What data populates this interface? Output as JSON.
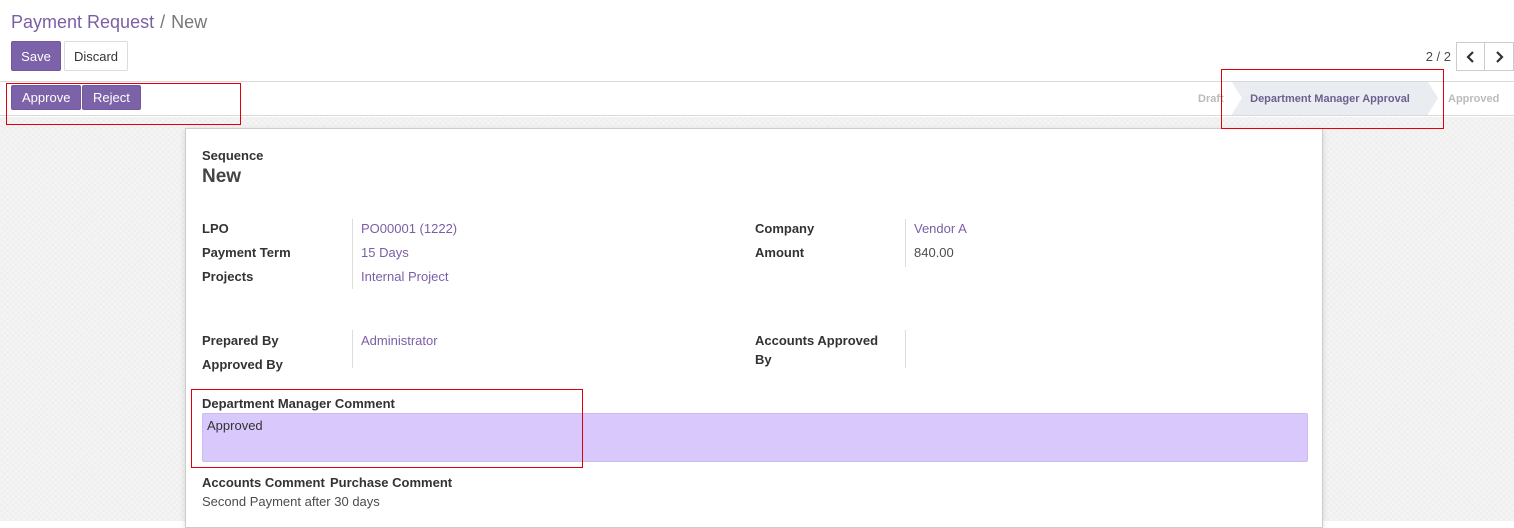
{
  "breadcrumb": {
    "parent": "Payment Request",
    "separator": "/",
    "current": "New"
  },
  "toolbar": {
    "save_label": "Save",
    "discard_label": "Discard"
  },
  "pager": {
    "value": "2 / 2"
  },
  "statusbar": {
    "approve_label": "Approve",
    "reject_label": "Reject",
    "stages": [
      "Draft",
      "Department Manager Approval",
      "Approved"
    ],
    "active_stage": "Department Manager Approval"
  },
  "form": {
    "sequence_label": "Sequence",
    "sequence_value": "New",
    "lpo_label": "LPO",
    "lpo_value": "PO00001 (1222)",
    "payment_term_label": "Payment Term",
    "payment_term_value": "15 Days",
    "projects_label": "Projects",
    "projects_value": "Internal Project",
    "company_label": "Company",
    "company_value": "Vendor A",
    "amount_label": "Amount",
    "amount_value": "840.00",
    "prepared_by_label": "Prepared By",
    "prepared_by_value": "Administrator",
    "approved_by_label": "Approved By",
    "accounts_approved_by_label_1": "Accounts Approved",
    "accounts_approved_by_label_2": "By",
    "dept_comment_label": "Department Manager Comment",
    "dept_comment_value": "Approved",
    "accounts_comment_label": "Accounts Comment",
    "purchase_comment_label": "Purchase Comment",
    "purchase_comment_value": "Second Payment after 30 days"
  },
  "colors": {
    "primary": "#7c62a8",
    "comment_bg": "#d8c8fb",
    "highlight": "#e0000b"
  }
}
